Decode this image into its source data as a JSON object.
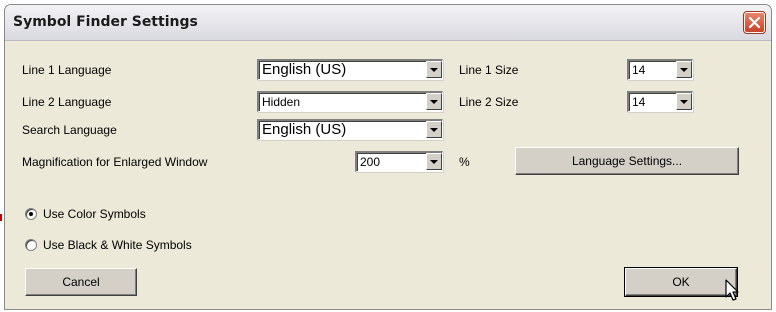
{
  "window": {
    "title": "Symbol Finder Settings",
    "close_icon": "close-x-icon"
  },
  "fields": {
    "line1_language": {
      "label": "Line 1 Language",
      "value": "English (US)"
    },
    "line2_language": {
      "label": "Line 2 Language",
      "value": "Hidden"
    },
    "search_language": {
      "label": "Search Language",
      "value": "English (US)"
    },
    "magnification": {
      "label": "Magnification for Enlarged Window",
      "value": "200",
      "unit": "%"
    },
    "line1_size": {
      "label": "Line 1 Size",
      "value": "14"
    },
    "line2_size": {
      "label": "Line 2 Size",
      "value": "14"
    }
  },
  "buttons": {
    "language_settings": "Language Settings...",
    "cancel": "Cancel",
    "ok": "OK"
  },
  "radios": {
    "color_symbols": {
      "label": "Use Color Symbols",
      "selected": true
    },
    "bw_symbols": {
      "label": "Use Black & White Symbols",
      "selected": false
    }
  },
  "colors": {
    "dialog_bg": "#ece9d8",
    "close_button": "#c6432a"
  }
}
